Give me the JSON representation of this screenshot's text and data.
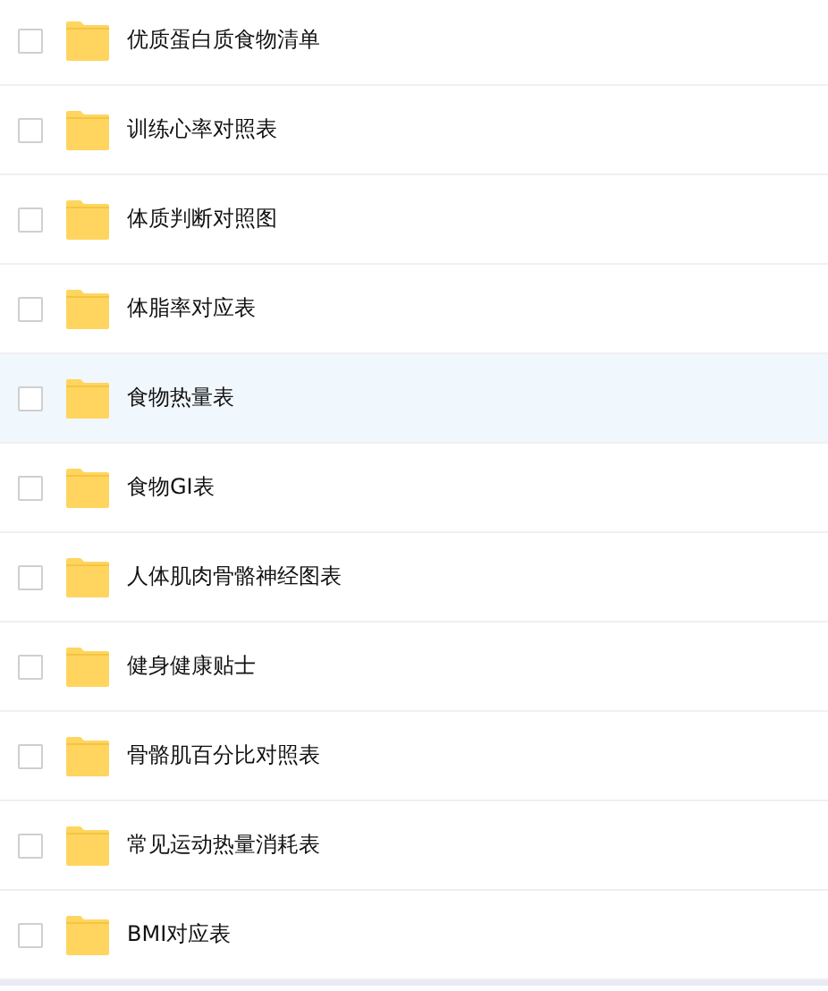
{
  "folders": [
    {
      "name": "优质蛋白质食物清单",
      "checked": false,
      "highlighted": false
    },
    {
      "name": "训练心率对照表",
      "checked": false,
      "highlighted": false
    },
    {
      "name": "体质判断对照图",
      "checked": false,
      "highlighted": false
    },
    {
      "name": "体脂率对应表",
      "checked": false,
      "highlighted": false
    },
    {
      "name": "食物热量表",
      "checked": false,
      "highlighted": true
    },
    {
      "name": "食物GI表",
      "checked": false,
      "highlighted": false
    },
    {
      "name": "人体肌肉骨骼神经图表",
      "checked": false,
      "highlighted": false
    },
    {
      "name": "健身健康贴士",
      "checked": false,
      "highlighted": false
    },
    {
      "name": "骨骼肌百分比对照表",
      "checked": false,
      "highlighted": false
    },
    {
      "name": "常见运动热量消耗表",
      "checked": false,
      "highlighted": false
    },
    {
      "name": "BMI对应表",
      "checked": false,
      "highlighted": false
    }
  ]
}
